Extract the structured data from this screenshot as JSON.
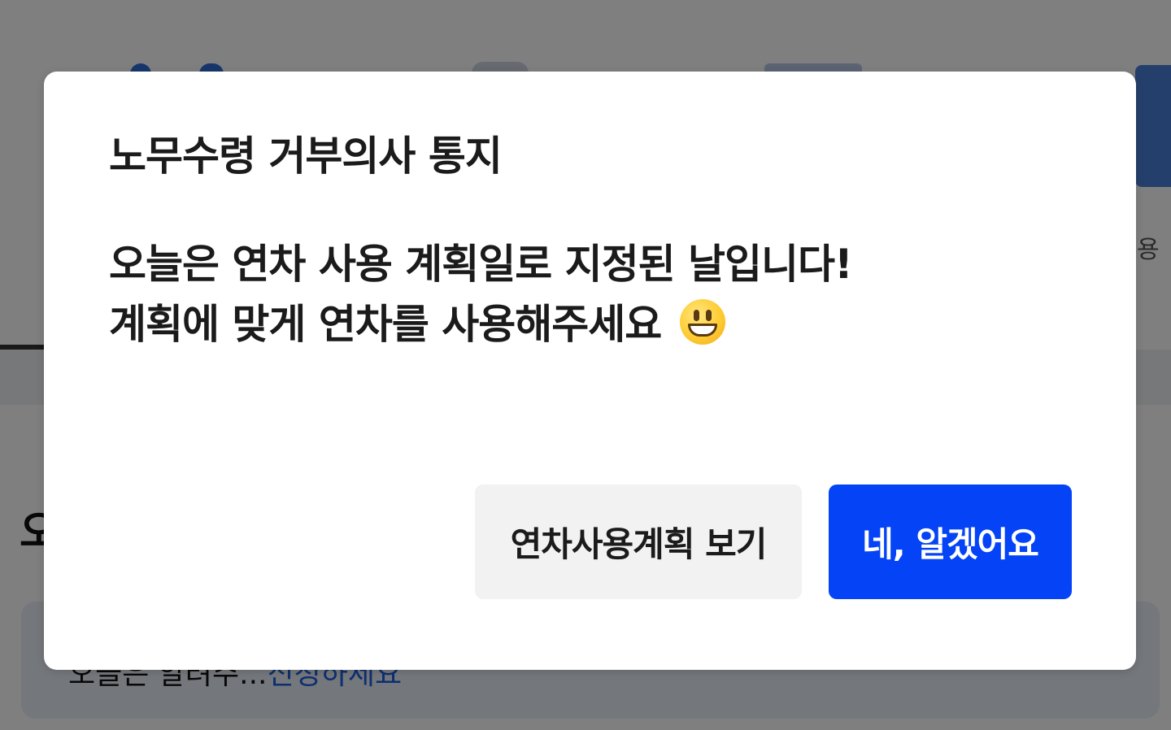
{
  "background": {
    "side_label": "용",
    "section_title": "오",
    "notice_text": "오늘은 알려주...",
    "notice_link": "신청하세요"
  },
  "dialog": {
    "title": "노무수령 거부의사 통지",
    "message_line1": "오늘은 연차 사용 계획일로 지정된 날입니다!",
    "message_line2": "계획에 맞게 연차를 사용해주세요",
    "message_emoji": "grinning-face-icon",
    "secondary_button": "연차사용계획 보기",
    "primary_button": "네, 알겠어요"
  },
  "colors": {
    "primary": "#0543f7",
    "secondary_bg": "#f2f2f2",
    "overlay": "rgba(0,0,0,0.5)"
  }
}
